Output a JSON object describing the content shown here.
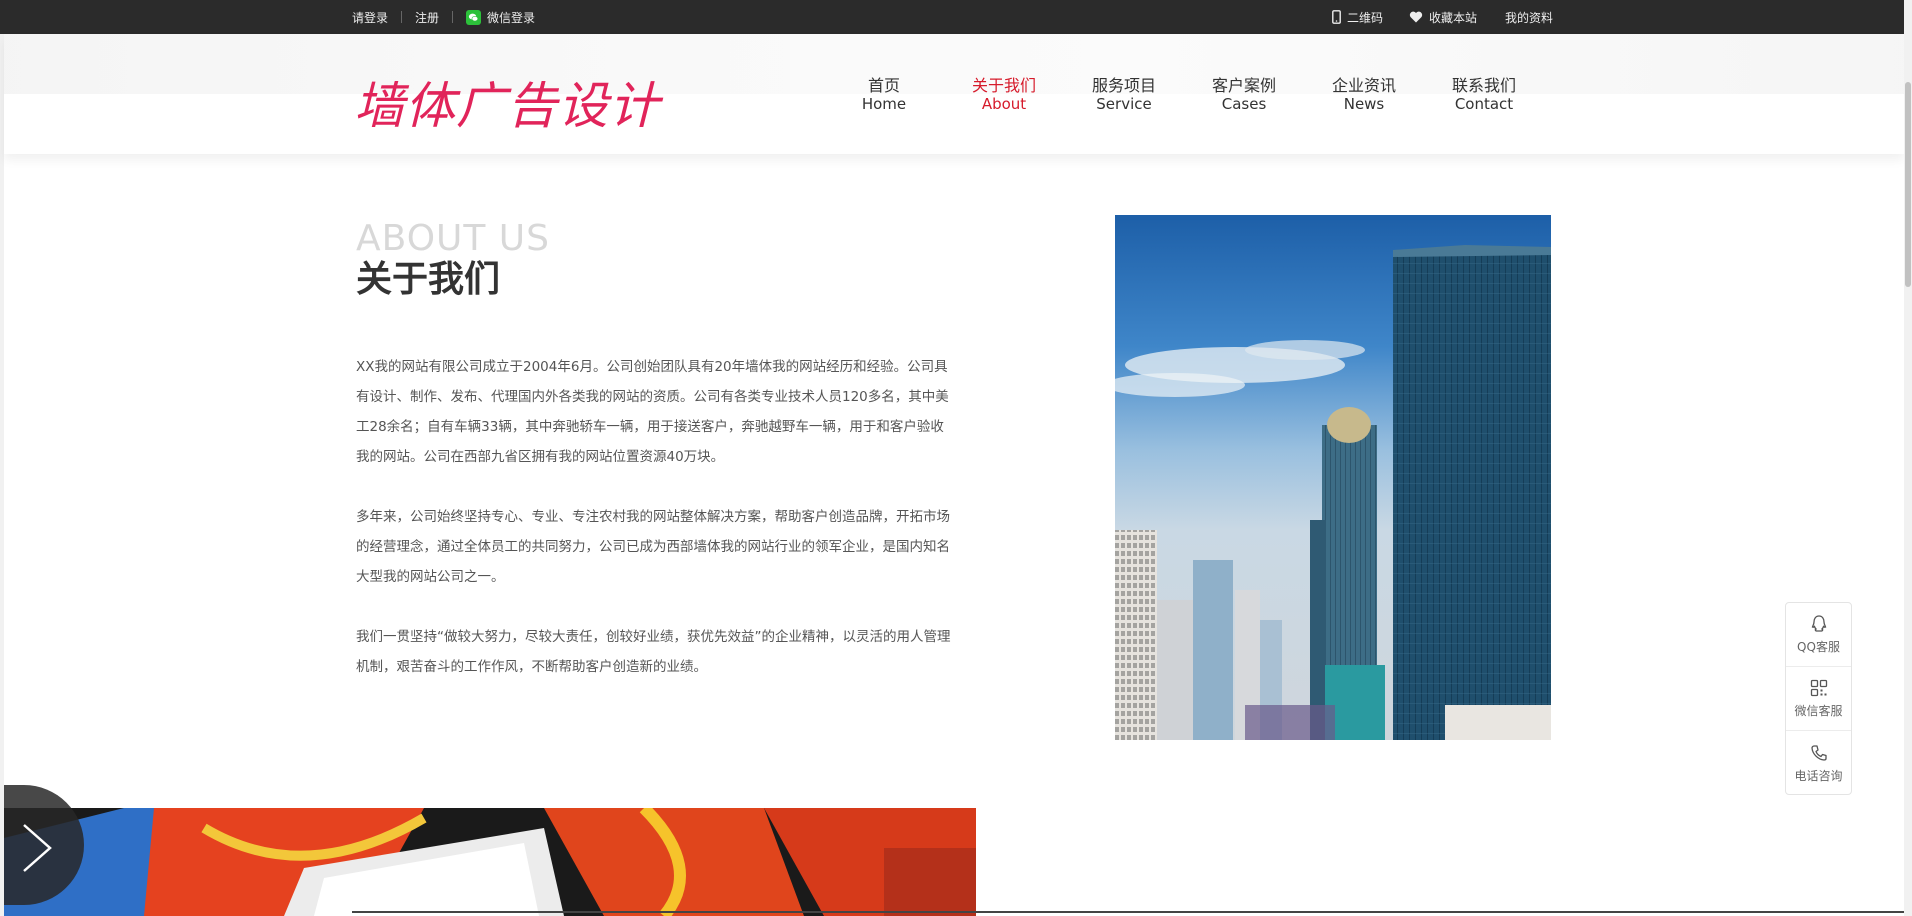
{
  "topbar": {
    "login": "请登录",
    "register": "注册",
    "wechat_login": "微信登录",
    "qrcode": "二维码",
    "favorite": "收藏本站",
    "my_profile": "我的资料"
  },
  "header": {
    "logo": "墙体广告设计",
    "nav": [
      {
        "cn": "首页",
        "en": "Home"
      },
      {
        "cn": "关于我们",
        "en": "About"
      },
      {
        "cn": "服务项目",
        "en": "Service"
      },
      {
        "cn": "客户案例",
        "en": "Cases"
      },
      {
        "cn": "企业资讯",
        "en": "News"
      },
      {
        "cn": "联系我们",
        "en": "Contact"
      }
    ]
  },
  "about": {
    "title_en": "ABOUT US",
    "title_cn": "关于我们",
    "paragraphs": [
      "XX我的网站有限公司成立于2004年6月。公司创始团队具有20年墙体我的网站经历和经验。公司具有设计、制作、发布、代理国内外各类我的网站的资质。公司有各类专业技术人员120多名，其中美工28余名；自有车辆33辆，其中奔驰轿车一辆，用于接送客户，奔驰越野车一辆，用于和客户验收我的网站。公司在西部九省区拥有我的网站位置资源40万块。",
      "多年来，公司始终坚持专心、专业、专注农村我的网站整体解决方案，帮助客户创造品牌，开拓市场的经营理念，通过全体员工的共同努力，公司已成为西部墙体我的网站行业的领军企业，是国内知名大型我的网站公司之一。",
      "我们一贯坚持“做较大努力，尽较大责任，创较好业绩，获优先效益”的企业精神，以灵活的用人管理机制，艰苦奋斗的工作作风，不断帮助客户创造新的业绩。"
    ]
  },
  "float": {
    "qq": "QQ客服",
    "wechat": "微信客服",
    "phone": "电话咨询"
  },
  "colors": {
    "accent": "#d61b2b",
    "logo": "#e1245a",
    "topbar_bg": "#2b2b2b"
  }
}
